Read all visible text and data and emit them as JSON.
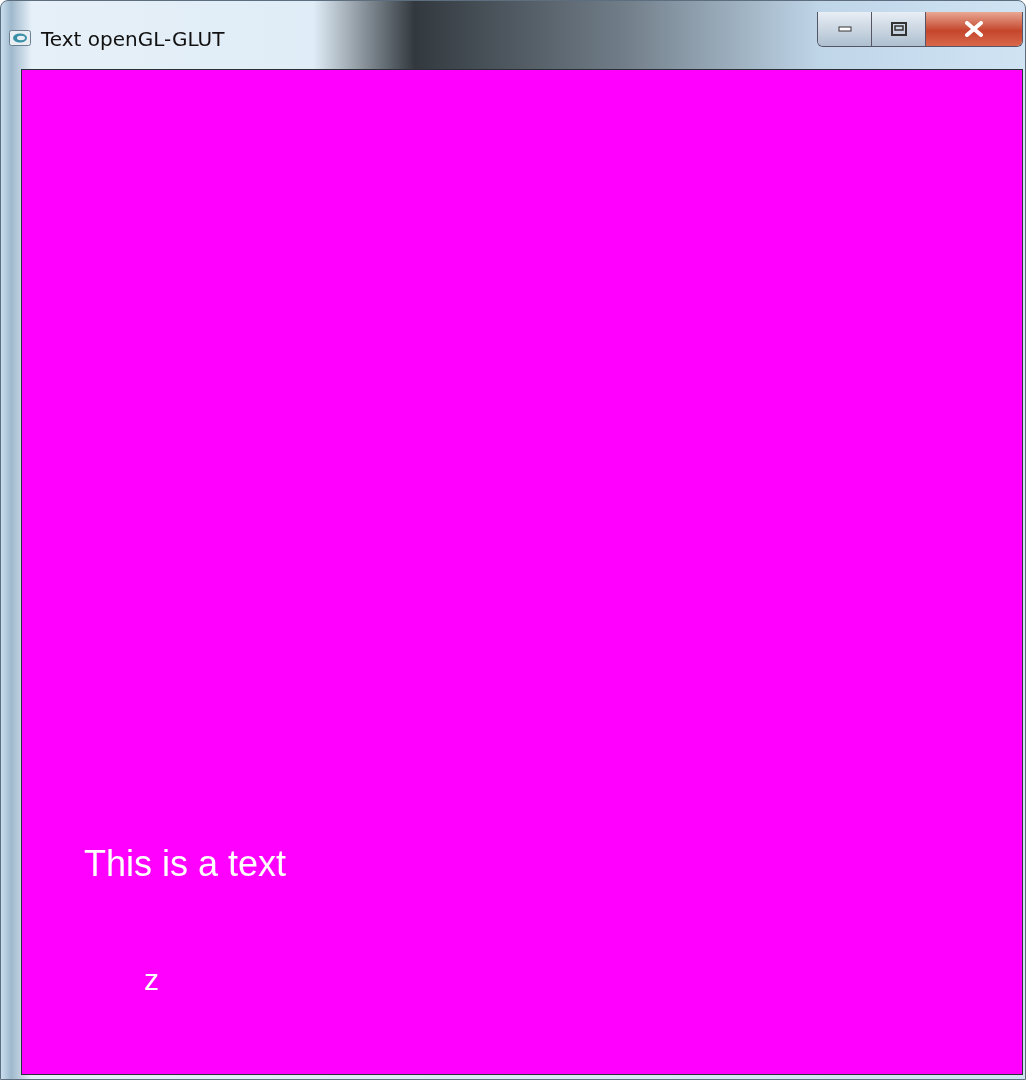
{
  "window": {
    "title": "Text openGL-GLUT"
  },
  "canvas": {
    "texts": [
      "This is a text",
      "z"
    ]
  }
}
